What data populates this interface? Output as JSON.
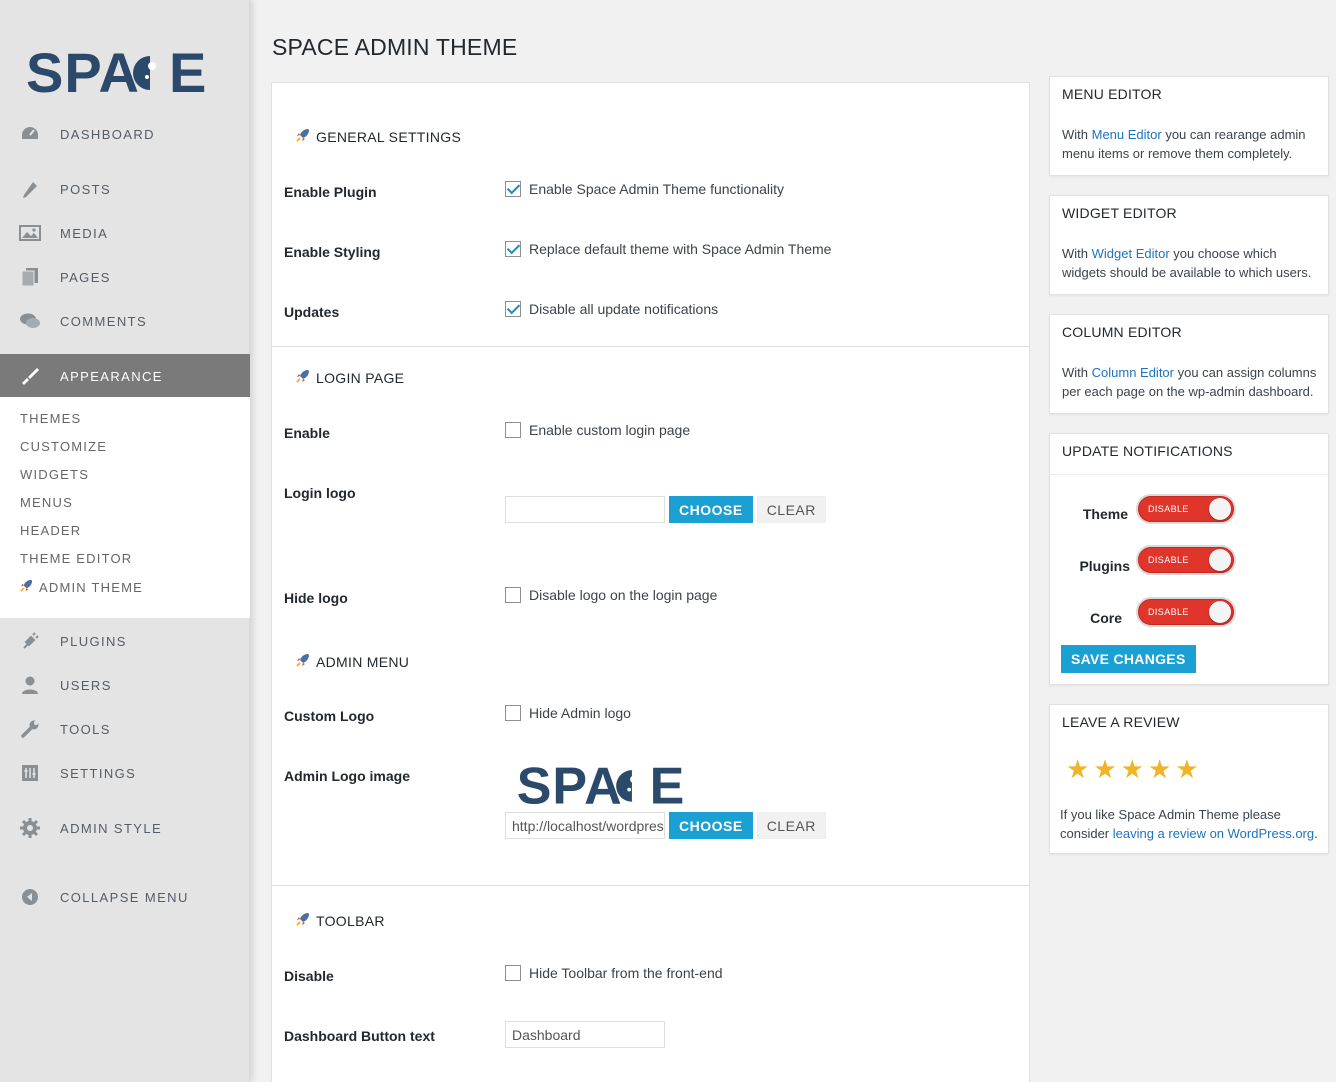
{
  "brand": {
    "logo_text": "SPACE"
  },
  "sidebar": {
    "items": [
      {
        "label": "DASHBOARD",
        "icon": "dashboard-icon"
      },
      {
        "label": "POSTS",
        "icon": "pin-icon"
      },
      {
        "label": "MEDIA",
        "icon": "media-icon"
      },
      {
        "label": "PAGES",
        "icon": "pages-icon"
      },
      {
        "label": "COMMENTS",
        "icon": "comments-icon"
      },
      {
        "label": "APPEARANCE",
        "icon": "paintbrush-icon"
      },
      {
        "label": "PLUGINS",
        "icon": "plug-icon"
      },
      {
        "label": "USERS",
        "icon": "user-icon"
      },
      {
        "label": "TOOLS",
        "icon": "wrench-icon"
      },
      {
        "label": "SETTINGS",
        "icon": "settings-icon"
      },
      {
        "label": "ADMIN STYLE",
        "icon": "gear-icon"
      },
      {
        "label": "COLLAPSE MENU",
        "icon": "collapse-icon"
      }
    ],
    "submenu": [
      "THEMES",
      "CUSTOMIZE",
      "WIDGETS",
      "MENUS",
      "HEADER",
      "THEME EDITOR",
      "ADMIN THEME"
    ]
  },
  "page": {
    "title": "SPACE ADMIN THEME"
  },
  "general": {
    "heading": "GENERAL SETTINGS",
    "enable_plugin_label": "Enable Plugin",
    "enable_plugin_text": "Enable Space Admin Theme functionality",
    "enable_styling_label": "Enable Styling",
    "enable_styling_text": "Replace default theme with Space Admin Theme",
    "updates_label": "Updates",
    "updates_text": "Disable all update notifications"
  },
  "login": {
    "heading": "LOGIN PAGE",
    "enable_label": "Enable",
    "enable_text": "Enable custom login page",
    "logo_label": "Login logo",
    "logo_value": "",
    "hide_logo_label": "Hide logo",
    "hide_logo_text": "Disable logo on the login page"
  },
  "admin_menu": {
    "heading": "ADMIN MENU",
    "custom_logo_label": "Custom Logo",
    "custom_logo_text": "Hide Admin logo",
    "logo_image_label": "Admin Logo image",
    "logo_image_value": "http://localhost/wordpress"
  },
  "toolbar": {
    "heading": "TOOLBAR",
    "disable_label": "Disable",
    "disable_text": "Hide Toolbar from the front-end",
    "dashboard_label": "Dashboard Button text",
    "dashboard_value": "Dashboard"
  },
  "buttons": {
    "choose": "CHOOSE",
    "clear": "CLEAR"
  },
  "widgets": {
    "menu_editor": {
      "title": "MENU EDITOR",
      "pre": "With ",
      "link": "Menu Editor",
      "post": " you can rearange admin menu items or remove them completely."
    },
    "widget_editor": {
      "title": "WIDGET EDITOR",
      "pre": "With ",
      "link": "Widget Editor",
      "post": " you choose which widgets should be available to which users."
    },
    "column_editor": {
      "title": "COLUMN EDITOR",
      "pre": "With ",
      "link": "Column Editor",
      "post": " you can assign columns per each page on the wp-admin dashboard."
    },
    "update_notifications": {
      "title": "UPDATE NOTIFICATIONS",
      "toggles": [
        {
          "label": "Theme",
          "state": "DISABLE"
        },
        {
          "label": "Plugins",
          "state": "DISABLE"
        },
        {
          "label": "Core",
          "state": "DISABLE"
        }
      ],
      "save": "SAVE CHANGES"
    },
    "review": {
      "title": "LEAVE A REVIEW",
      "stars": 5,
      "pre": "If you like Space Admin Theme please consider ",
      "link": "leaving a review on WordPress.org",
      "post": "."
    }
  },
  "colors": {
    "accent": "#1ba0d3",
    "logo": "#2b4a6b",
    "toggle": "#e0352b",
    "star": "#f0b429"
  }
}
